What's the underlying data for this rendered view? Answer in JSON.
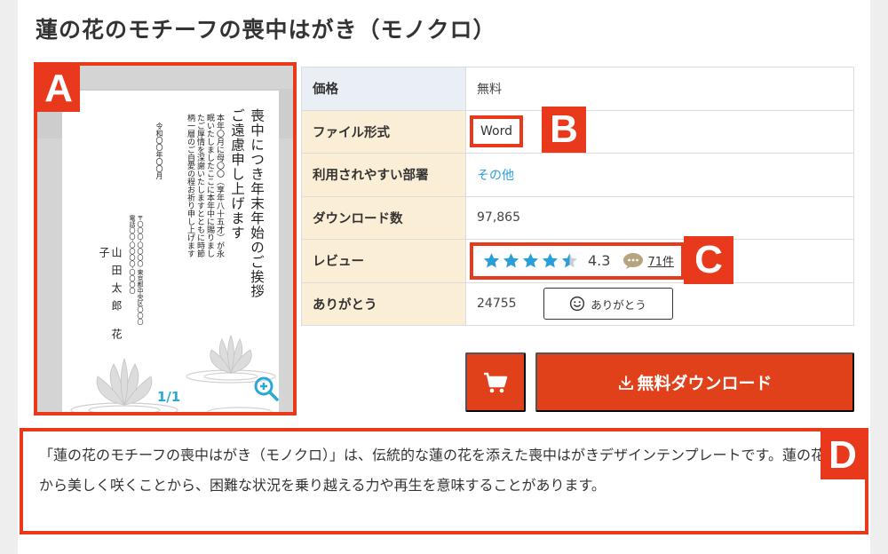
{
  "title": "蓮の花のモチーフの喪中はがき（モノクロ）",
  "preview": {
    "main_text": "喪中につき年末年始のご挨拶ご遠慮申し上げます",
    "body_text": "本年〇月に母〇〇（享年八十五才）が永眠いたしましたここに本年中に賜りましたご厚情を深謝いたしますとともに時節柄一層のご自愛の程お祈り申し上げます",
    "date_text": "令和〇〇年〇〇月",
    "address_text": "〒〇〇〇‐〇〇〇〇 東京都中央区〇〇〇 電話〇〇‐〇〇〇〇‐〇〇〇〇",
    "name_text": "山田太郎 花子",
    "pager": "1/1",
    "zoom_icon": "zoom-in-icon"
  },
  "badges": {
    "a": "A",
    "b": "B",
    "c": "C",
    "d": "D"
  },
  "table": {
    "price_label": "価格",
    "price_value": "無料",
    "format_label": "ファイル形式",
    "format_value": "Word",
    "dept_label": "利用されやすい部署",
    "dept_value": "その他",
    "downloads_label": "ダウンロード数",
    "downloads_value": "97,865",
    "review_label": "レビュー",
    "review_rating": "4.3",
    "review_count": "71件",
    "thanks_label": "ありがとう",
    "thanks_count": "24755",
    "thanks_button": "ありがとう"
  },
  "rating_value": 4.3,
  "actions": {
    "download_label": "無料ダウンロード",
    "cart_icon": "cart-icon",
    "download_icon": "download-icon"
  },
  "description": "「蓮の花のモチーフの喪中はがき（モノクロ）」は、伝統的な蓮の花を添えた喪中はがきデザインテンプレートです。蓮の花は泥の中から美しく咲くことから、困難な状況を乗り越える力や再生を意味することがあります。",
  "colors": {
    "accent": "#e0411a",
    "highlight": "#e8391d",
    "link": "#2a9ed6",
    "star": "#2a9ed6"
  }
}
